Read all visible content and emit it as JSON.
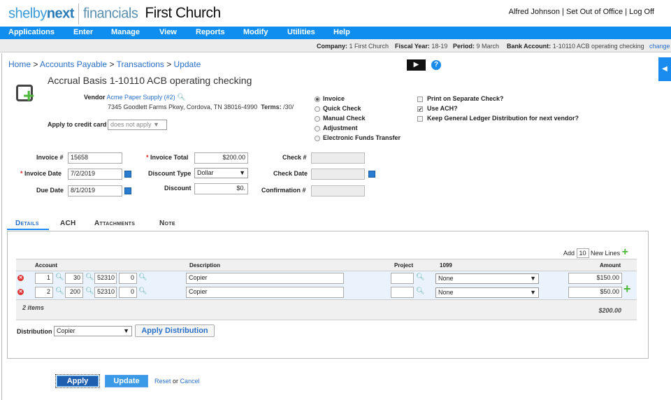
{
  "header": {
    "brand1": "shelby",
    "brand2": "next",
    "product": "financials",
    "church": "First Church",
    "user": "Alfred Johnson",
    "out_of_office": "Set Out of Office",
    "logoff": "Log Off",
    "sep": "|"
  },
  "nav": [
    "Applications",
    "Enter",
    "Manage",
    "View",
    "Reports",
    "Modify",
    "Utilities",
    "Help"
  ],
  "info": {
    "company_label": "Company:",
    "company": "1 First Church",
    "fy_label": "Fiscal Year:",
    "fy": "18-19",
    "period_label": "Period:",
    "period": "9 March",
    "bank_label": "Bank Account:",
    "bank": "1-10110 ACB operating checking",
    "change": "change"
  },
  "breadcrumb": [
    "Home",
    "Accounts Payable",
    "Transactions",
    "Update"
  ],
  "breadcrumb_sep": ">",
  "title": "Accrual Basis 1-10110 ACB operating checking",
  "vendor": {
    "label": "Vendor",
    "name": "Acme Paper Supply (#2)",
    "address": "7345 Goodlett Farms Pkwy, Cordova, TN 38016-4990",
    "terms_label": "Terms:",
    "terms": "/30/",
    "credit_label": "Apply to credit card",
    "credit_value": "does not apply"
  },
  "payment_types": [
    {
      "label": "Invoice",
      "selected": true
    },
    {
      "label": "Quick Check",
      "selected": false
    },
    {
      "label": "Manual Check",
      "selected": false
    },
    {
      "label": "Adjustment",
      "selected": false
    },
    {
      "label": "Electronic Funds Transfer",
      "selected": false
    }
  ],
  "options": [
    {
      "label": "Print on Separate Check?",
      "checked": false
    },
    {
      "label": "Use ACH?",
      "checked": true
    },
    {
      "label": "Keep General Ledger Distribution for next vendor?",
      "checked": false
    }
  ],
  "form": {
    "invoice_no_label": "Invoice #",
    "invoice_no": "15658",
    "invoice_date_label": "Invoice Date",
    "invoice_date": "7/2/2019",
    "due_date_label": "Due Date",
    "due_date": "8/1/2019",
    "total_label": "Invoice Total",
    "total": "$200.00",
    "discount_type_label": "Discount Type",
    "discount_type": "Dollar",
    "discount_label": "Discount",
    "discount": "$0.",
    "check_no_label": "Check #",
    "check_no": "",
    "check_date_label": "Check Date",
    "check_date": "",
    "confirmation_label": "Confirmation #",
    "confirmation": "",
    "req": "*"
  },
  "tabs": [
    "Details",
    "ACH",
    "Attachments",
    "Note"
  ],
  "details": {
    "add_label": "Add",
    "add_count": "10",
    "new_lines_label": "New Lines",
    "columns": [
      "Account",
      "Description",
      "Project",
      "1099",
      "Amount"
    ],
    "rows": [
      {
        "a1": "1",
        "a2": "30",
        "a3": "52310",
        "a4": "0",
        "desc": "Copier",
        "project": "",
        "f1099": "None",
        "amount": "$150.00"
      },
      {
        "a1": "2",
        "a2": "200",
        "a3": "52310",
        "a4": "0",
        "desc": "Copier",
        "project": "",
        "f1099": "None",
        "amount": "$50.00"
      }
    ],
    "item_count": "2 items",
    "total": "$200.00",
    "distribution_label": "Distribution",
    "distribution": "Copier",
    "apply_distribution": "Apply Distribution"
  },
  "footer": {
    "apply": "Apply",
    "update": "Update",
    "reset": "Reset",
    "or": "or",
    "cancel": "Cancel"
  }
}
